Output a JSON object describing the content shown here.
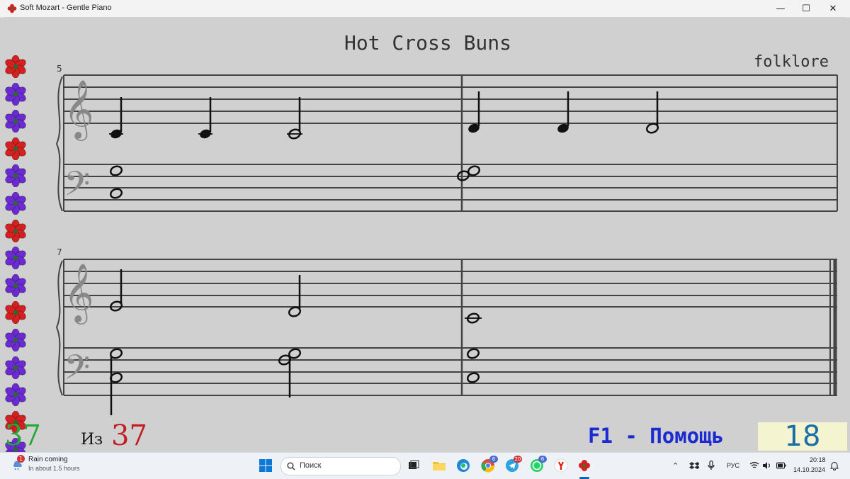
{
  "window": {
    "title": "Soft Mozart - Gentle Piano",
    "controls": {
      "minimize": "—",
      "maximize": "☐",
      "close": "✕"
    }
  },
  "score": {
    "title": "Hot Cross Buns",
    "composer": "folklore",
    "systems": [
      {
        "measure_number": "5"
      },
      {
        "measure_number": "7"
      }
    ]
  },
  "progress": {
    "flowers": [
      "red",
      "purple",
      "purple",
      "red",
      "purple",
      "purple",
      "red",
      "purple",
      "purple",
      "red",
      "purple",
      "purple",
      "purple",
      "red",
      "purple"
    ],
    "completed": "37",
    "of_label": "Из",
    "total": "37"
  },
  "help_hint": "F1 - Помощь",
  "score_value": "18",
  "colors": {
    "flower_red": "#d42020",
    "flower_purple": "#6a2bd0",
    "completed": "#22aa33",
    "total": "#c02020",
    "help": "#1a2bd0",
    "score_bg": "#f4f4d0",
    "score_text": "#1a6ea8"
  },
  "taskbar": {
    "weather": {
      "badge": "1",
      "title": "Rain coming",
      "subtitle": "In about 1.5 hours"
    },
    "search_placeholder": "Поиск",
    "apps": [
      {
        "icon": "task-view-icon"
      },
      {
        "icon": "file-explorer-icon"
      },
      {
        "icon": "edge-icon"
      },
      {
        "icon": "chrome-icon",
        "badge": "6"
      },
      {
        "icon": "telegram-icon",
        "badge": "20"
      },
      {
        "icon": "whatsapp-icon",
        "badge": "6"
      },
      {
        "icon": "yandex-icon"
      },
      {
        "icon": "soft-mozart-icon"
      }
    ],
    "tray": {
      "language": "РУС",
      "time": "20:18",
      "date": "14.10.2024"
    }
  }
}
